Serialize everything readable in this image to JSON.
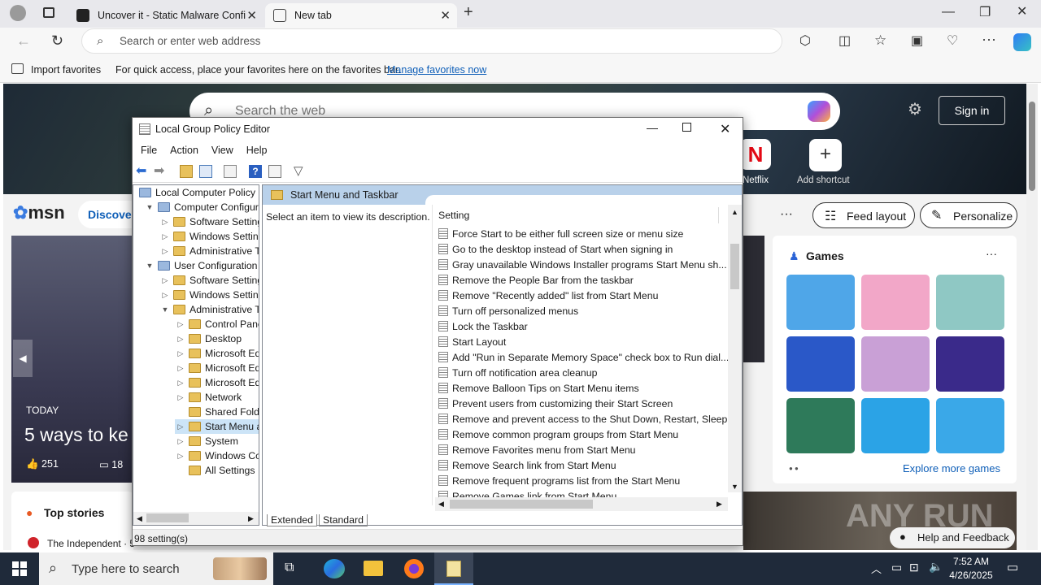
{
  "browser": {
    "tabs": [
      {
        "title": "Uncover it - Static Malware Confi"
      },
      {
        "title": "New tab"
      }
    ],
    "address_placeholder": "Search or enter web address",
    "favbar": {
      "import": "Import favorites",
      "hint": "For quick access, place your favorites here on the favorites bar.",
      "manage": "Manage favorites now"
    }
  },
  "newtab": {
    "search_placeholder": "Search the web",
    "signin": "Sign in",
    "shortcuts": [
      {
        "label": "Netflix"
      },
      {
        "label": "Add shortcut"
      }
    ],
    "msn": "msn",
    "discover": "Discover",
    "feed_layout": "Feed layout",
    "personalize": "Personalize",
    "games_title": "Games",
    "explore": "Explore more games",
    "hero_tag": "TODAY",
    "hero_title": "5 ways to ke",
    "likes": "251",
    "comments": "18",
    "top_stories": "Top stories",
    "story_source": "The Independent · 5",
    "help": "Help and Feedback",
    "watermark": "ANY RUN"
  },
  "gpo": {
    "title": "Local Group Policy Editor",
    "menu": [
      "File",
      "Action",
      "View",
      "Help"
    ],
    "tree": [
      {
        "label": "Local Computer Policy",
        "level": 0,
        "arrow": ""
      },
      {
        "label": "Computer Configura",
        "level": 1,
        "arrow": "v"
      },
      {
        "label": "Software Settings",
        "level": 2,
        "arrow": ">"
      },
      {
        "label": "Windows Setting",
        "level": 2,
        "arrow": ">"
      },
      {
        "label": "Administrative Te",
        "level": 2,
        "arrow": ">"
      },
      {
        "label": "User Configuration",
        "level": 1,
        "arrow": "v"
      },
      {
        "label": "Software Settings",
        "level": 2,
        "arrow": ">"
      },
      {
        "label": "Windows Setting",
        "level": 2,
        "arrow": ">"
      },
      {
        "label": "Administrative Te",
        "level": 2,
        "arrow": "v"
      },
      {
        "label": "Control Panel",
        "level": 3,
        "arrow": ">"
      },
      {
        "label": "Desktop",
        "level": 3,
        "arrow": ">"
      },
      {
        "label": "Microsoft Edg",
        "level": 3,
        "arrow": ">"
      },
      {
        "label": "Microsoft Edg",
        "level": 3,
        "arrow": ">"
      },
      {
        "label": "Microsoft Edg",
        "level": 3,
        "arrow": ">"
      },
      {
        "label": "Network",
        "level": 3,
        "arrow": ">"
      },
      {
        "label": "Shared Folder",
        "level": 3,
        "arrow": ""
      },
      {
        "label": "Start Menu ar",
        "level": 3,
        "arrow": ">",
        "selected": true
      },
      {
        "label": "System",
        "level": 3,
        "arrow": ">"
      },
      {
        "label": "Windows Cor",
        "level": 3,
        "arrow": ">"
      },
      {
        "label": "All Settings",
        "level": 3,
        "arrow": ""
      }
    ],
    "folder_title": "Start Menu and Taskbar",
    "description": "Select an item to view its description.",
    "setting_header": "Setting",
    "settings": [
      "Force Start to be either full screen size or menu size",
      "Go to the desktop instead of Start when signing in",
      "Gray unavailable Windows Installer programs Start Menu sh...",
      "Remove the People Bar from the taskbar",
      "Remove \"Recently added\" list from Start Menu",
      "Turn off personalized menus",
      "Lock the Taskbar",
      "Start Layout",
      "Add \"Run in Separate Memory Space\" check box to Run dial...",
      "Turn off notification area cleanup",
      "Remove Balloon Tips on Start Menu items",
      "Prevent users from customizing their Start Screen",
      "Remove and prevent access to the Shut Down, Restart, Sleep...",
      "Remove common program groups from Start Menu",
      "Remove Favorites menu from Start Menu",
      "Remove Search link from Start Menu",
      "Remove frequent programs list from the Start Menu",
      "Remove Games link from Start Menu"
    ],
    "tabs": [
      "Extended",
      "Standard"
    ],
    "status": "98 setting(s)"
  },
  "taskbar": {
    "search": "Type here to search",
    "time": "7:52 AM",
    "date": "4/26/2025"
  }
}
